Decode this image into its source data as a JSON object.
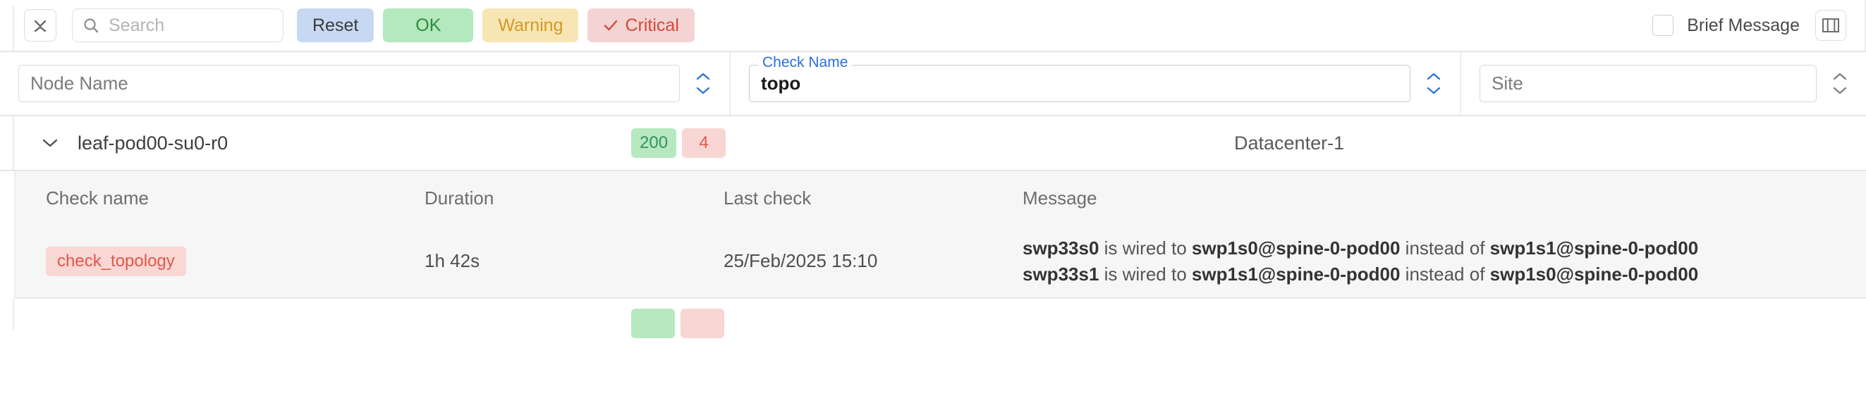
{
  "toolbar": {
    "collapse_icon": "collapse-rows-icon",
    "search": {
      "placeholder": "Search",
      "value": "",
      "icon": "search-icon"
    },
    "reset_label": "Reset",
    "status_filters": [
      {
        "label": "OK",
        "state": "unselected",
        "color": "#b4e8bd"
      },
      {
        "label": "Warning",
        "state": "unselected",
        "color": "#f8e5b4"
      },
      {
        "label": "Critical",
        "state": "selected",
        "color": "#f4d4d2",
        "icon": "check-icon"
      }
    ],
    "brief_message": {
      "label": "Brief Message",
      "checked": false
    },
    "columns_icon": "columns-layout-icon"
  },
  "filters": [
    {
      "name": "node-name",
      "label": "",
      "placeholder": "Node Name",
      "value": "",
      "focused": false,
      "sort_icon": "sort-chevrons-icon"
    },
    {
      "name": "check-name",
      "label": "Check Name",
      "placeholder": "",
      "value": "topo",
      "focused": true,
      "sort_icon": "sort-chevrons-icon"
    },
    {
      "name": "site",
      "label": "",
      "placeholder": "Site",
      "value": "",
      "focused": false,
      "sort_icon": "sort-chevrons-icon"
    }
  ],
  "node": {
    "expand_icon": "chevron-down-icon",
    "name": "leaf-pod00-su0-r0",
    "ok_count": "200",
    "critical_count": "4",
    "site": "Datacenter-1"
  },
  "table": {
    "headers": {
      "check_name": "Check name",
      "duration": "Duration",
      "last_check": "Last check",
      "message": "Message"
    },
    "rows": [
      {
        "check_name": "check_topology",
        "duration": "1h 42s",
        "last_check": "25/Feb/2025 15:10",
        "message_lines": [
          [
            {
              "t": "swp33s0",
              "b": true
            },
            {
              "t": " is wired to ",
              "b": false
            },
            {
              "t": "swp1s0@spine-0-pod00",
              "b": true
            },
            {
              "t": " instead of ",
              "b": false
            },
            {
              "t": "swp1s1@spine-0-pod00",
              "b": true
            }
          ],
          [
            {
              "t": "swp33s1",
              "b": true
            },
            {
              "t": " is wired to ",
              "b": false
            },
            {
              "t": "swp1s1@spine-0-pod00",
              "b": true
            },
            {
              "t": " instead of ",
              "b": false
            },
            {
              "t": "swp1s0@spine-0-pod00",
              "b": true
            }
          ]
        ]
      }
    ]
  },
  "next_node": {
    "ok_count": "",
    "critical_count": ""
  },
  "colors": {
    "ok": "#2c8a3e",
    "warning": "#d19a26",
    "critical": "#d4483c",
    "accent_blue": "#2a6fdb",
    "reset_bg": "#c7d9f2"
  }
}
